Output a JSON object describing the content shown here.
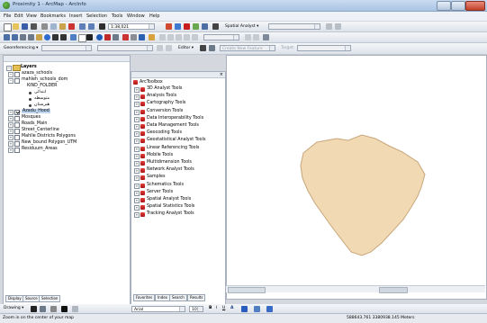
{
  "window": {
    "title": "Proximity 1 - ArcMap - ArcInfo"
  },
  "menu": [
    "File",
    "Edit",
    "View",
    "Bookmarks",
    "Insert",
    "Selection",
    "Tools",
    "Window",
    "Help"
  ],
  "toolbar": {
    "scale_value": "1:38,021",
    "spatial_analyst_label": "Spatial Analyst ▾",
    "georeferencing_label": "Georeferencing ▾",
    "editor_label": "Editor ▾",
    "create_features_label": "Create New Feature",
    "target_label": "Target:"
  },
  "toc": {
    "root_label": "Layers",
    "items": [
      {
        "label": "azaza_schools",
        "checked": false,
        "expanded": true
      },
      {
        "label": "mahleh_schools_dom",
        "checked": false,
        "expanded": true
      },
      {
        "label": "KIND_FOLDER",
        "sub": true
      },
      {
        "label": "ابتدائی",
        "sub": true,
        "legend": "#3a3a3a"
      },
      {
        "label": "متوسطه",
        "sub": true,
        "legend": "#3a3a3a"
      },
      {
        "label": "هنرستان",
        "sub": true,
        "legend": "#3a3a3a"
      },
      {
        "label": "Azadu_Hood",
        "checked": true,
        "selected": true
      },
      {
        "label": "Mosques",
        "checked": false
      },
      {
        "label": "Roads_Main",
        "checked": false
      },
      {
        "label": "Street_Centerline",
        "checked": false
      },
      {
        "label": "Mahlle Districts Polygons",
        "checked": false
      },
      {
        "label": "New_bound Polygon_UTM",
        "checked": false
      },
      {
        "label": "Residuum_Areas",
        "checked": false
      }
    ],
    "tabs": [
      "Display",
      "Source",
      "Selection"
    ]
  },
  "toolbox": {
    "root_label": "ArcToolbox",
    "items": [
      "3D Analyst Tools",
      "Analysis Tools",
      "Cartography Tools",
      "Conversion Tools",
      "Data Interoperability Tools",
      "Data Management Tools",
      "Geocoding Tools",
      "Geostatistical Analyst Tools",
      "Linear Referencing Tools",
      "Mobile Tools",
      "Multidimension Tools",
      "Network Analyst Tools",
      "Samples",
      "Schematics Tools",
      "Server Tools",
      "Spatial Analyst Tools",
      "Spatial Statistics Tools",
      "Tracking Analyst Tools"
    ],
    "tabs": [
      "Favorites",
      "Index",
      "Search",
      "Results"
    ]
  },
  "drawing": {
    "label": "Drawing ▾",
    "font_value": "Arial",
    "size_value": "10"
  },
  "status": {
    "message": "Zoom in on the center of your map",
    "coordinates": "588643.761  3380938.145 Meters"
  },
  "colors": {
    "polygon_fill": "#f1d9b3",
    "polygon_stroke": "#c7a77b",
    "toolbox_icon": "#c4221d",
    "selection": "#bfd6f0"
  }
}
